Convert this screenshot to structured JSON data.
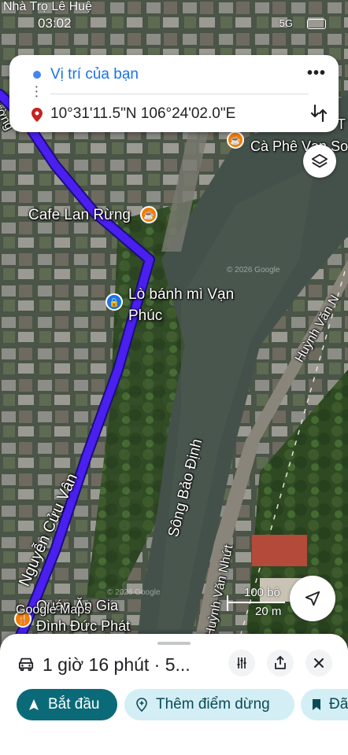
{
  "status_bar": {
    "notification": "Nhà Trọ Lê Huệ",
    "time": "03:02",
    "network": "5G"
  },
  "route_card": {
    "origin": "Vị trí của bạn",
    "destination": "10°31'11.5\"N 106°24'02.0\"E",
    "more_icon": "more-horiz-icon",
    "swap_icon": "swap-vert-icon"
  },
  "map": {
    "places": {
      "cafe_top": "Cà Phê Vạn So",
      "cafe_lan_rung": "Cafe Lan Rừng",
      "bakery_line1": "Lò bánh mì Vạn",
      "bakery_line2": "Phúc",
      "restaurant_line1": "Quán Ăn Gia",
      "restaurant_line2": "Đình Đức Phát",
      "top_right_snip": "T"
    },
    "roads": {
      "nguyen_cuu_van": "Nguyễn Cửu Vân",
      "huynh_van_nhut": "Huỳnh Văn Nhứt",
      "huynh_van_top": "Huỳnh Văn N",
      "top_left_road": "ường"
    },
    "river": "Sông Bảo Định",
    "attribution": "Google Maps",
    "watermark_a": "© 2026 Google",
    "watermark_b": "© 2026 Google",
    "scale_bar": {
      "label_top": "100 bộ",
      "label_bottom": "20 m"
    },
    "colors": {
      "route": "#4a1ff0",
      "poi_food": "#f57c00",
      "poi_store": "#1a73e8",
      "accent_button": "#0b6a78",
      "chip_bg": "#d3eef5"
    }
  },
  "bottom_sheet": {
    "summary": "1 giờ 16 phút · 5...",
    "start_label": "Bắt đầu",
    "add_stop_label": "Thêm điểm dừng",
    "save_label": "Đã"
  }
}
